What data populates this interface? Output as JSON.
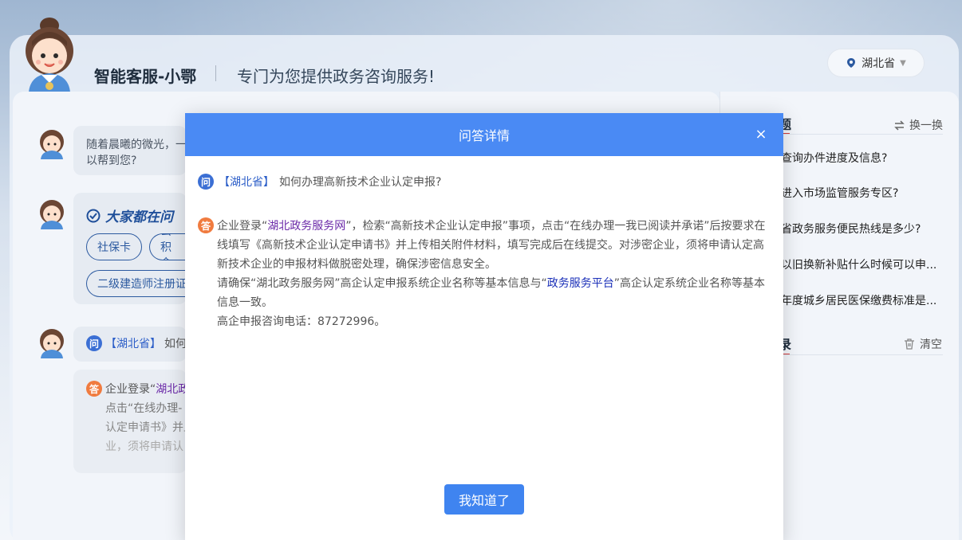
{
  "header": {
    "brand": "智能客服-小鄂",
    "slogan": "专门为您提供政务咨询服务!",
    "region": "湖北省"
  },
  "chat": {
    "greeting": "随着晨曦的微光，一",
    "greeting_line2": "以帮到您?",
    "card_title": "大家都在问",
    "tags": [
      "社保卡",
      "公积金",
      "二级建造师注册证"
    ],
    "question_region": "【湖北省】",
    "question_partial": "如何",
    "answer_line1": "企业登录“",
    "answer_line1_link": "湖北政",
    "answer_line2": "点击“在线办理-",
    "answer_line3": "认定申请书》并上",
    "answer_line4": "业，须将申请认"
  },
  "side": {
    "hot_title_tail": "题",
    "refresh_label": "换一换",
    "items": [
      "查询办件进度及信息?",
      "进入市场监管服务专区?",
      "省政务服务便民热线是多少?",
      "以旧换新补贴什么时候可以申...",
      "年度城乡居民医保缴费标准是..."
    ],
    "history_title_tail": "录",
    "clear_label": "清空"
  },
  "modal": {
    "title": "问答详情",
    "close": "×",
    "q_icon": "问",
    "a_icon": "答",
    "question_region": "【湖北省】",
    "question_text": "如何办理高新技术企业认定申报?",
    "answer": {
      "p1_a": "企业登录“",
      "p1_link": "湖北政务服务网",
      "p1_b": "”，检索“高新技术企业认定申报”事项，点击“在线办理一我已阅读并承诺”后按要求在线填写《高新技术企业认定申请书》并上传相关附件材料，填写完成后在线提交。对涉密企业，须将申请认定高新技术企业的申报材料做脱密处理，确保涉密信息安全。",
      "p2_a": "请确保“湖北政务服务网”高企认定申报系统企业名称等基本信息与“",
      "p2_link": "政务服务平台",
      "p2_b": "”高企认定系统企业名称等基本信息一致。",
      "p3": "高企申报咨询电话：87272996。"
    },
    "ok_label": "我知道了"
  },
  "colors": {
    "modal_header": "#4a8af4",
    "ok_button": "#3f84f0",
    "question_icon": "#3b6fd4",
    "answer_icon": "#f07b3f",
    "underline_accent": "#d23b3b"
  }
}
